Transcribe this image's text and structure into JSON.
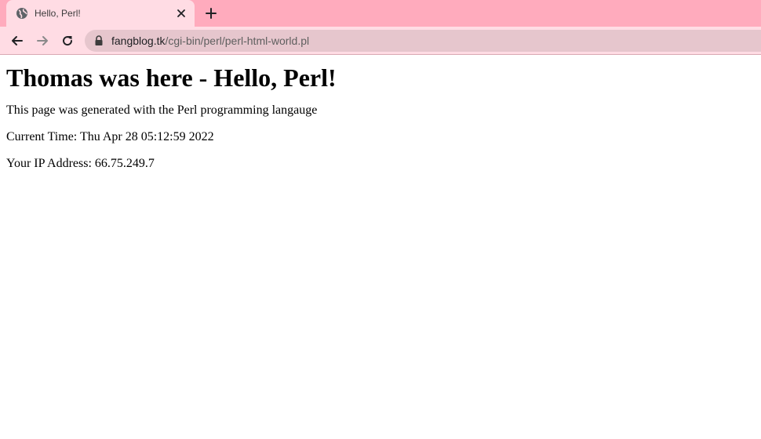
{
  "browser": {
    "tab": {
      "title": "Hello, Perl!",
      "favicon": "globe-icon"
    },
    "address_bar": {
      "host": "fangblog.tk",
      "path": "/cgi-bin/perl/perl-html-world.pl"
    },
    "colors": {
      "tab_strip": "#ffabbd",
      "active_tab": "#ffdce4",
      "omnibox": "#e6c6cd"
    }
  },
  "page": {
    "heading": "Thomas was here - Hello, Perl!",
    "description": "This page was generated with the Perl programming langauge",
    "current_time": "Current Time: Thu Apr 28 05:12:59 2022",
    "ip_address": "Your IP Address: 66.75.249.7"
  }
}
